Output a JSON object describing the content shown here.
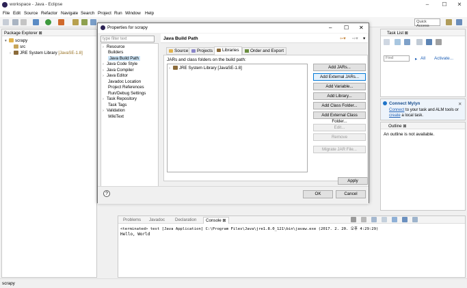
{
  "window": {
    "title": "workspace - Java - Eclipse",
    "minimize": "–",
    "maximize": "☐",
    "close": "✕"
  },
  "menu": [
    "File",
    "Edit",
    "Source",
    "Refactor",
    "Navigate",
    "Search",
    "Project",
    "Run",
    "Window",
    "Help"
  ],
  "toolbar": {
    "quick_access": "Quick Access"
  },
  "package_explorer": {
    "tab": "Package Explorer",
    "project": "scrapy",
    "items": [
      "src",
      "JRE System Library"
    ],
    "jre_version": "[JavaSE-1.8]"
  },
  "task_list": {
    "tab": "Task List",
    "find_placeholder": "Find",
    "all": "All",
    "activate": "Activate..."
  },
  "mylyn": {
    "title": "Connect Mylyn",
    "line1_link": "Connect",
    "line1_text": " to your task and ALM tools or",
    "line2_link": "create",
    "line2_text": " a local task."
  },
  "outline": {
    "tab": "Outline",
    "message": "An outline is not available."
  },
  "bottom_tabs": [
    "Problems",
    "Javadoc",
    "Declaration",
    "Console"
  ],
  "console": {
    "header": "<terminated> test [Java Application] C:\\Program Files\\Java\\jre1.8.0_121\\bin\\javaw.exe (2017. 2. 20. 오후 4:29:29)",
    "output": "Hello, World"
  },
  "status_bar": {
    "text": "scrapy"
  },
  "dialog": {
    "title": "Properties for scrapy",
    "filter_placeholder": "type filter text",
    "nav": [
      "Resource",
      "Builders",
      "Java Build Path",
      "Java Code Style",
      "Java Compiler",
      "Java Editor",
      "Javadoc Location",
      "Project References",
      "Run/Debug Settings",
      "Task Repository",
      "Task Tags",
      "Validation",
      "WikiText"
    ],
    "selected_nav": "Java Build Path",
    "section_title": "Java Build Path",
    "tabs": [
      "Source",
      "Projects",
      "Libraries",
      "Order and Export"
    ],
    "active_tab": "Libraries",
    "list_label": "JARs and class folders on the build path:",
    "list_items": [
      "JRE System Library [JavaSE-1.8]"
    ],
    "buttons": [
      "Add JARs...",
      "Add External JARs...",
      "Add Variable...",
      "Add Library...",
      "Add Class Folder...",
      "Add External Class Folder...",
      "Edit...",
      "Remove",
      "Migrate JAR File..."
    ],
    "apply": "Apply",
    "ok": "OK",
    "cancel": "Cancel",
    "help": "?"
  }
}
